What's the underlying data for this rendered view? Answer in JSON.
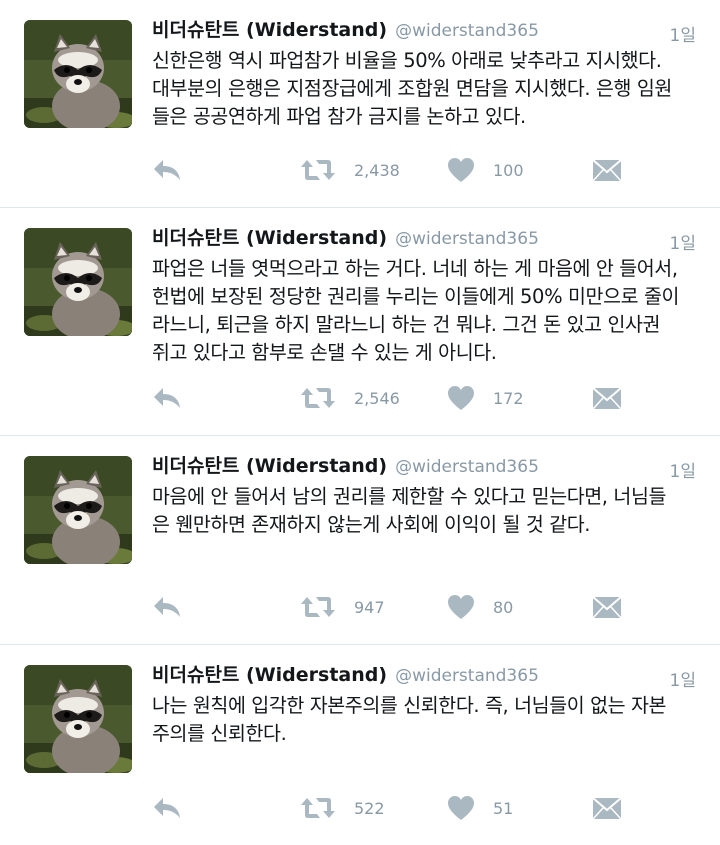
{
  "tweets": [
    {
      "name": "비더슈탄트 (Widerstand)",
      "handle": "@widerstand365",
      "time": "1일",
      "text": "신한은행 역시 파업참가 비율을 50% 아래로 낮추라고 지시했다.\n대부분의 은행은 지점장급에게 조합원 면담을 지시했다. 은행 임원\n들은 공공연하게 파업 참가 금지를 논하고 있다.",
      "retweets": "2,438",
      "likes": "100"
    },
    {
      "name": "비더슈탄트 (Widerstand)",
      "handle": "@widerstand365",
      "time": "1일",
      "text": "파업은 너들 엿먹으라고 하는 거다. 너네 하는 게 마음에 안 들어서,\n헌법에 보장된 정당한 권리를 누리는 이들에게 50% 미만으로 줄이\n라느니, 퇴근을 하지 말라느니 하는 건 뭐냐. 그건 돈 있고 인사권\n쥐고 있다고 함부로 손댈 수 있는 게 아니다.",
      "retweets": "2,546",
      "likes": "172"
    },
    {
      "name": "비더슈탄트 (Widerstand)",
      "handle": "@widerstand365",
      "time": "1일",
      "text": "마음에 안 들어서 남의 권리를 제한할 수 있다고 믿는다면, 너님들\n은 웬만하면 존재하지 않는게 사회에 이익이 될 것 같다.",
      "retweets": "947",
      "likes": "80"
    },
    {
      "name": "비더슈탄트 (Widerstand)",
      "handle": "@widerstand365",
      "time": "1일",
      "text": "나는 원칙에 입각한 자본주의를 신뢰한다. 즉, 너님들이 없는 자본\n주의를 신뢰한다.",
      "retweets": "522",
      "likes": "51"
    }
  ],
  "icons": {
    "reply": "reply-icon",
    "retweet": "retweet-icon",
    "like": "heart-icon",
    "dm": "envelope-icon",
    "avatar": "raccoon-avatar"
  },
  "colors": {
    "icon": "#aab8c2",
    "secondary_text": "#8899a6",
    "divider": "#e1e8ed"
  }
}
